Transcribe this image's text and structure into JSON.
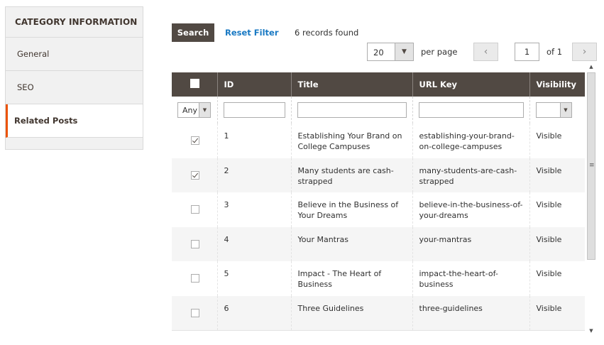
{
  "sidebar": {
    "title": "CATEGORY INFORMATION",
    "items": [
      {
        "label": "General"
      },
      {
        "label": "SEO"
      },
      {
        "label": "Related Posts"
      }
    ]
  },
  "toolbar": {
    "search_label": "Search",
    "reset_label": "Reset Filter",
    "records_text": "6 records found",
    "per_page_value": "20",
    "per_page_label": "per page",
    "current_page": "1",
    "of_label": "of 1"
  },
  "grid": {
    "columns": [
      "ID",
      "Title",
      "URL Key",
      "Visibility"
    ],
    "filters": {
      "select_any": "Any"
    },
    "rows": [
      {
        "checked": true,
        "id": "1",
        "title": "Establishing Your Brand on College Campuses",
        "url_key": "establishing-your-brand-on-college-campuses",
        "visibility": "Visible"
      },
      {
        "checked": true,
        "id": "2",
        "title": "Many students are cash-strapped",
        "url_key": "many-students-are-cash-strapped",
        "visibility": "Visible"
      },
      {
        "checked": false,
        "id": "3",
        "title": "Believe in the Business of Your Dreams",
        "url_key": "believe-in-the-business-of-your-dreams",
        "visibility": "Visible"
      },
      {
        "checked": false,
        "id": "4",
        "title": "Your Mantras",
        "url_key": "your-mantras",
        "visibility": "Visible"
      },
      {
        "checked": false,
        "id": "5",
        "title": "Impact - The Heart of Business",
        "url_key": "impact-the-heart-of-business",
        "visibility": "Visible"
      },
      {
        "checked": false,
        "id": "6",
        "title": "Three Guidelines",
        "url_key": "three-guidelines",
        "visibility": "Visible"
      }
    ]
  },
  "colors": {
    "header_bg": "#514943",
    "accent": "#eb5202",
    "link": "#1979c3"
  }
}
